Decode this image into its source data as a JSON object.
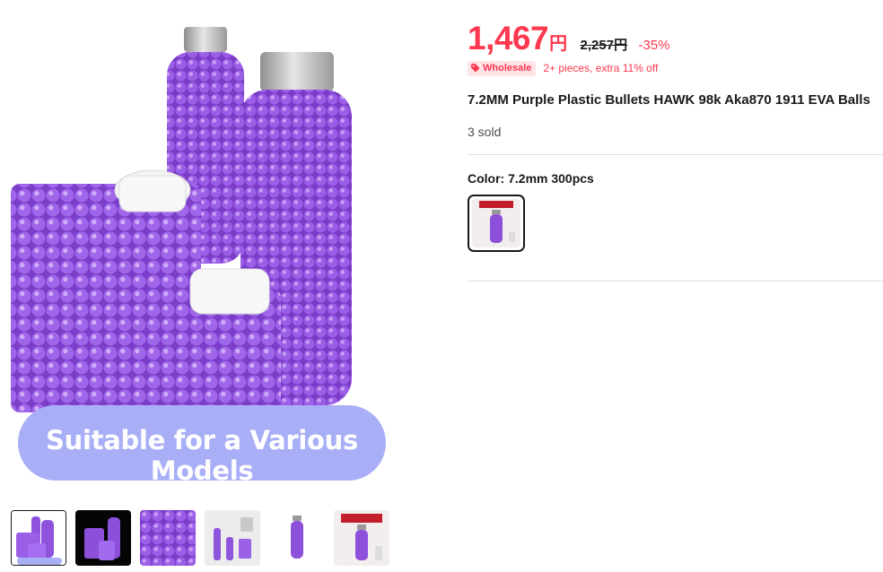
{
  "gallery": {
    "banner_text": "Suitable for a Various Models",
    "thumbnail_count": 6,
    "active_thumbnail": 1
  },
  "price": {
    "current": "1,467",
    "currency": "円",
    "original": "2,257円",
    "discount": "-35%",
    "accent_color": "#fd384f"
  },
  "wholesale": {
    "badge_label": "Wholesale",
    "note": "2+ pieces, extra 11% off"
  },
  "product": {
    "title": "7.2MM Purple Plastic Bullets HAWK 98k Aka870 1911 EVA Balls",
    "sold": "3 sold"
  },
  "color_option": {
    "label": "Color: 7.2mm 300pcs",
    "selected": "7.2mm 300pcs"
  },
  "icons": {
    "wholesale": "tag-icon"
  }
}
